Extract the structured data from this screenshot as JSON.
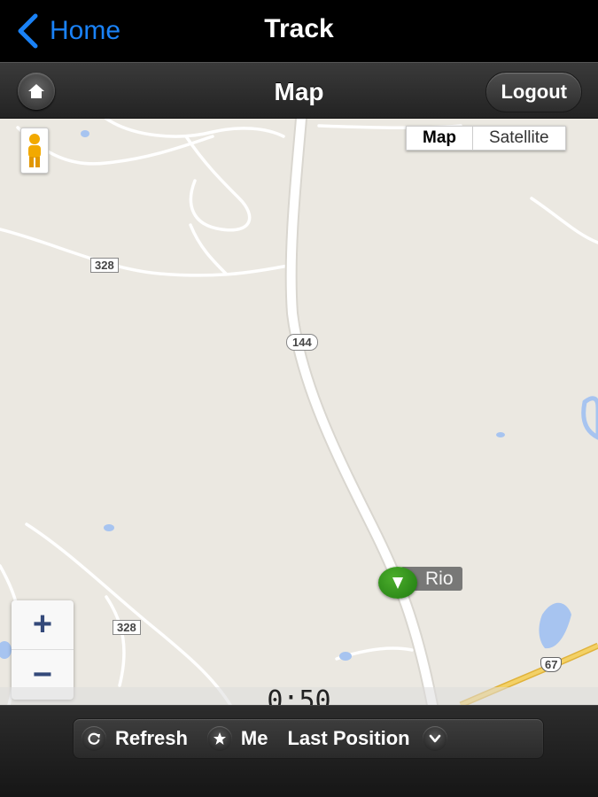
{
  "navbar": {
    "back_label": "Home",
    "title": "Track"
  },
  "header": {
    "title": "Map",
    "logout_label": "Logout"
  },
  "map": {
    "map_type_options": [
      "Map",
      "Satellite"
    ],
    "selected_map_type": "Map",
    "road_labels": {
      "r328_top": "328",
      "r144": "144",
      "r328_bottom": "328",
      "us67": "67"
    },
    "marker_label": "Rio",
    "zoom_in": "+",
    "zoom_out": "−",
    "timer": "0:50"
  },
  "footer": {
    "refresh_label": "Refresh",
    "me_label": "Me",
    "last_position_label": "Last Position"
  },
  "colors": {
    "accent": "#1a82f7",
    "marker": "#2e8b1a",
    "map_bg": "#ebe8e1",
    "highway": "#f0c84a",
    "water": "#a7c4f0"
  },
  "icons": {
    "back": "chevron-left-icon",
    "home": "home-icon",
    "pegman": "pegman-icon",
    "refresh": "refresh-icon",
    "me": "star-icon",
    "more": "chevron-down-icon",
    "marker": "direction-arrow-icon"
  }
}
